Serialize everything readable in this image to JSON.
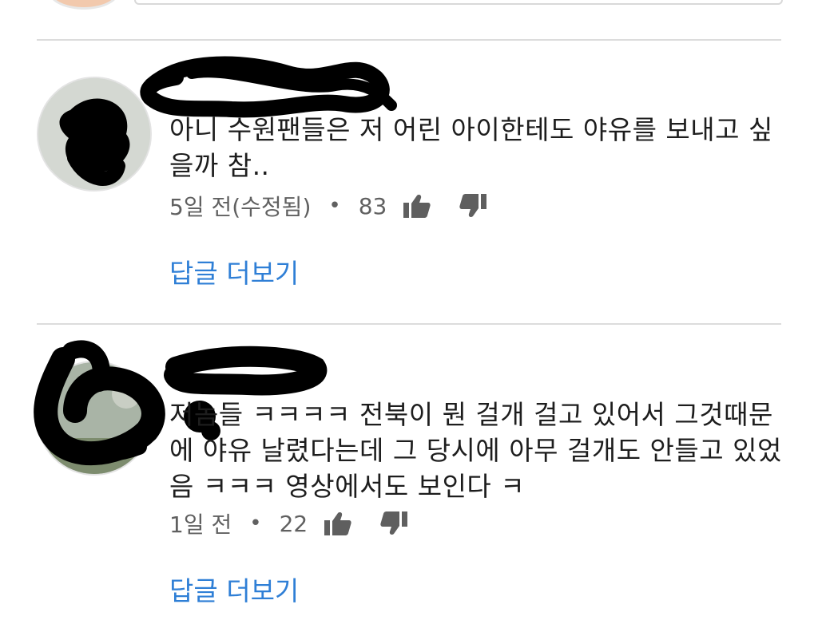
{
  "comments": [
    {
      "author": "",
      "text": "아니 수원팬들은 저 어린 아이한테도 야유를 보내고 싶을까 참..",
      "time": "5일 전(수정됨)",
      "separator": "•",
      "likes": "83",
      "reply_label": "답글 더보기"
    },
    {
      "author": "",
      "text": "저놈들 ㅋㅋㅋㅋ 전북이 뭔 걸개 걸고 있어서 그것때문에 야유 날렸다는데 그 당시에 아무 걸개도 안들고 있었음 ㅋㅋㅋ 영상에서도 보인다 ㅋ",
      "time": "1일 전",
      "separator": "•",
      "likes": "22",
      "reply_label": "답글 더보기"
    }
  ],
  "icons": {
    "like": "thumbs-up-icon",
    "dislike": "thumbs-down-icon"
  },
  "colors": {
    "link": "#2f7fd6",
    "meta": "#606060",
    "divider": "#dcdcdc"
  }
}
